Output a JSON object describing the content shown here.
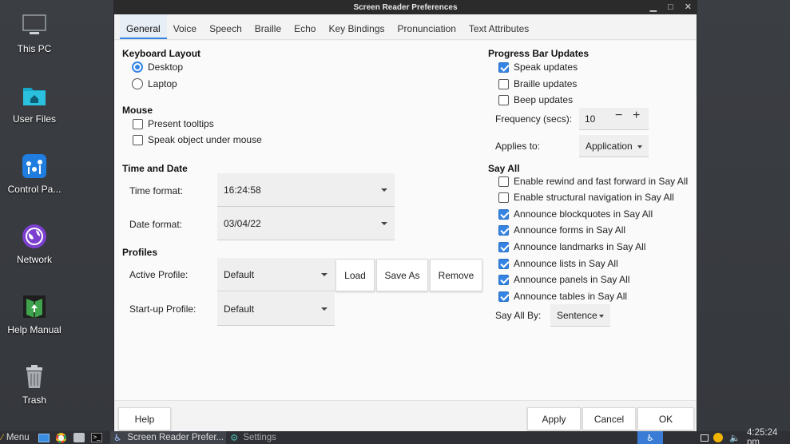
{
  "desktop": {
    "icons": [
      {
        "label": "This PC"
      },
      {
        "label": "User Files"
      },
      {
        "label": "Control Pa..."
      },
      {
        "label": "Network"
      },
      {
        "label": "Help Manual"
      },
      {
        "label": "Trash"
      }
    ]
  },
  "window": {
    "title": "Screen Reader Preferences",
    "controls": {
      "minimize": "▁",
      "maximize": "□",
      "close": "✕"
    },
    "tabs": [
      "General",
      "Voice",
      "Speech",
      "Braille",
      "Echo",
      "Key Bindings",
      "Pronunciation",
      "Text Attributes"
    ],
    "active_tab": "General"
  },
  "general": {
    "keyboard_layout": {
      "heading": "Keyboard Layout",
      "options": [
        {
          "label": "Desktop",
          "selected": true
        },
        {
          "label": "Laptop",
          "selected": false
        }
      ]
    },
    "mouse": {
      "heading": "Mouse",
      "options": [
        {
          "label": "Present tooltips",
          "checked": false
        },
        {
          "label": "Speak object under mouse",
          "checked": false
        }
      ]
    },
    "time_and_date": {
      "heading": "Time and Date",
      "time_label": "Time format:",
      "time_value": "16:24:58",
      "date_label": "Date format:",
      "date_value": "03/04/22"
    },
    "profiles": {
      "heading": "Profiles",
      "active_label": "Active Profile:",
      "active_value": "Default",
      "startup_label": "Start-up Profile:",
      "startup_value": "Default",
      "load_label": "Load",
      "save_as_label": "Save As",
      "remove_label": "Remove"
    },
    "progress_bar": {
      "heading": "Progress Bar Updates",
      "options": [
        {
          "label": "Speak updates",
          "checked": true
        },
        {
          "label": "Braille updates",
          "checked": false
        },
        {
          "label": "Beep updates",
          "checked": false
        }
      ],
      "frequency_label": "Frequency (secs):",
      "frequency_value": "10",
      "minus": "−",
      "plus": "+",
      "applies_label": "Applies to:",
      "applies_value": "Application"
    },
    "say_all": {
      "heading": "Say All",
      "options": [
        {
          "label": "Enable rewind and fast forward in Say All",
          "checked": false
        },
        {
          "label": "Enable structural navigation in Say All",
          "checked": false
        },
        {
          "label": "Announce blockquotes in Say All",
          "checked": true
        },
        {
          "label": "Announce forms in Say All",
          "checked": true
        },
        {
          "label": "Announce landmarks in Say All",
          "checked": true
        },
        {
          "label": "Announce lists in Say All",
          "checked": true
        },
        {
          "label": "Announce panels in Say All",
          "checked": true
        },
        {
          "label": "Announce tables in Say All",
          "checked": true
        }
      ],
      "by_label": "Say All By:",
      "by_value": "Sentence"
    }
  },
  "footer": {
    "help": "Help",
    "apply": "Apply",
    "cancel": "Cancel",
    "ok": "OK"
  },
  "taskbar": {
    "menu": "Menu",
    "app1": "Screen Reader Prefer...",
    "app2": "Settings",
    "clock": "4:25:24 pm"
  },
  "colors": {
    "accent": "#3584e4",
    "titlebar": "#2b2b2b",
    "desktop": "#3a3d42"
  }
}
